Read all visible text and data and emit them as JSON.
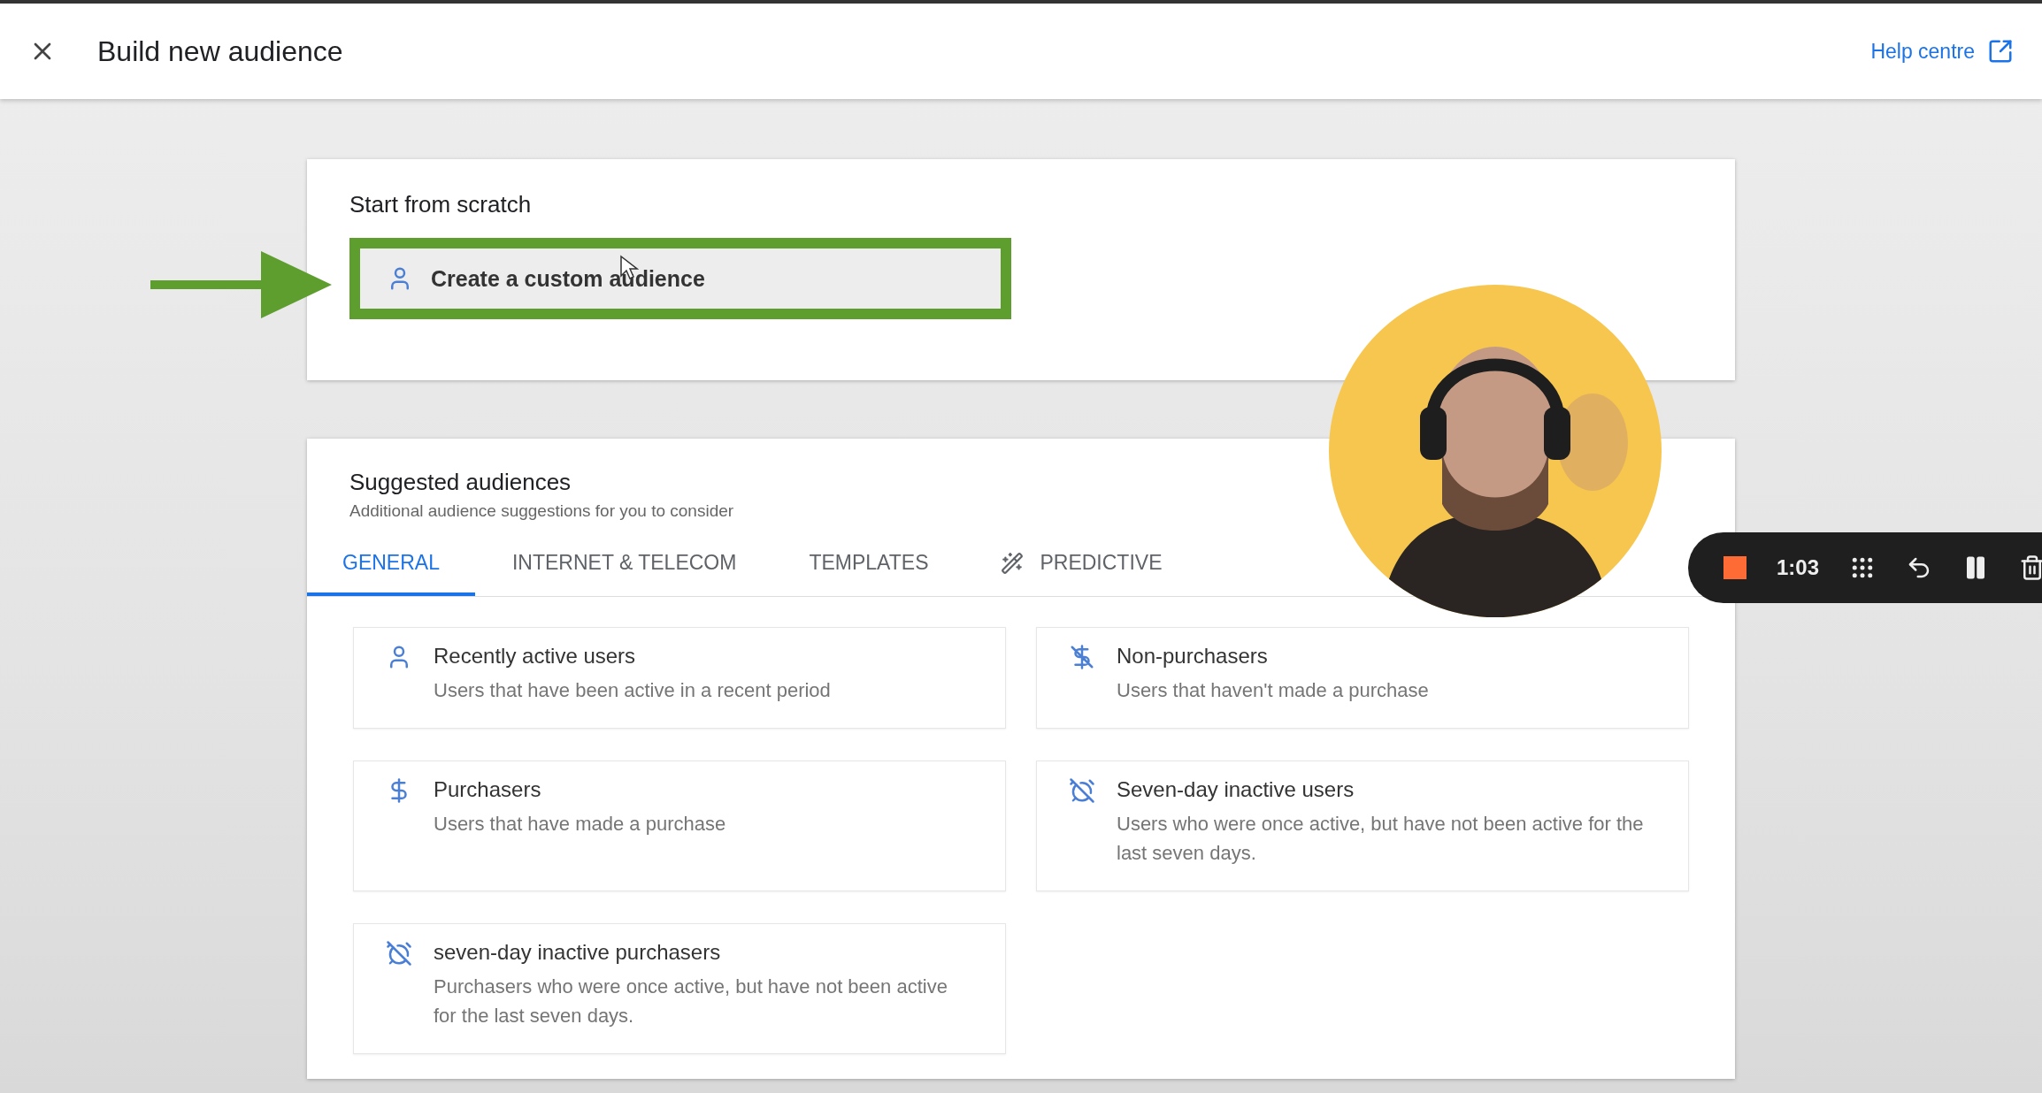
{
  "header": {
    "title": "Build new audience",
    "help_link": "Help centre"
  },
  "start_card": {
    "heading": "Start from scratch",
    "button": {
      "label": "Create a custom audience",
      "highlighted": true
    }
  },
  "suggested": {
    "heading": "Suggested audiences",
    "subheading": "Additional audience suggestions for you to consider",
    "tabs": [
      {
        "label": "GENERAL",
        "selected": true,
        "kind": "plain"
      },
      {
        "label": "INTERNET & TELECOM",
        "selected": false,
        "kind": "plain"
      },
      {
        "label": "TEMPLATES",
        "selected": false,
        "kind": "plain"
      },
      {
        "label": "PREDICTIVE",
        "selected": false,
        "kind": "predictive"
      }
    ],
    "items": [
      {
        "title": "Recently active users",
        "description": "Users that have been active in a recent period",
        "kind": "active"
      },
      {
        "title": "Non-purchasers",
        "description": "Users that haven't made a purchase",
        "kind": "nonpurchase"
      },
      {
        "title": "Purchasers",
        "description": "Users that have made a purchase",
        "kind": "purchase"
      },
      {
        "title": "Seven-day inactive users",
        "description": "Users who were once active, but have not been active for the last seven days.",
        "kind": "inactive"
      },
      {
        "title": "seven-day inactive purchasers",
        "description": "Purchasers who were once active, but have not been active for the last seven days.",
        "kind": "inactive"
      }
    ]
  },
  "recorder": {
    "time": "1:03"
  }
}
